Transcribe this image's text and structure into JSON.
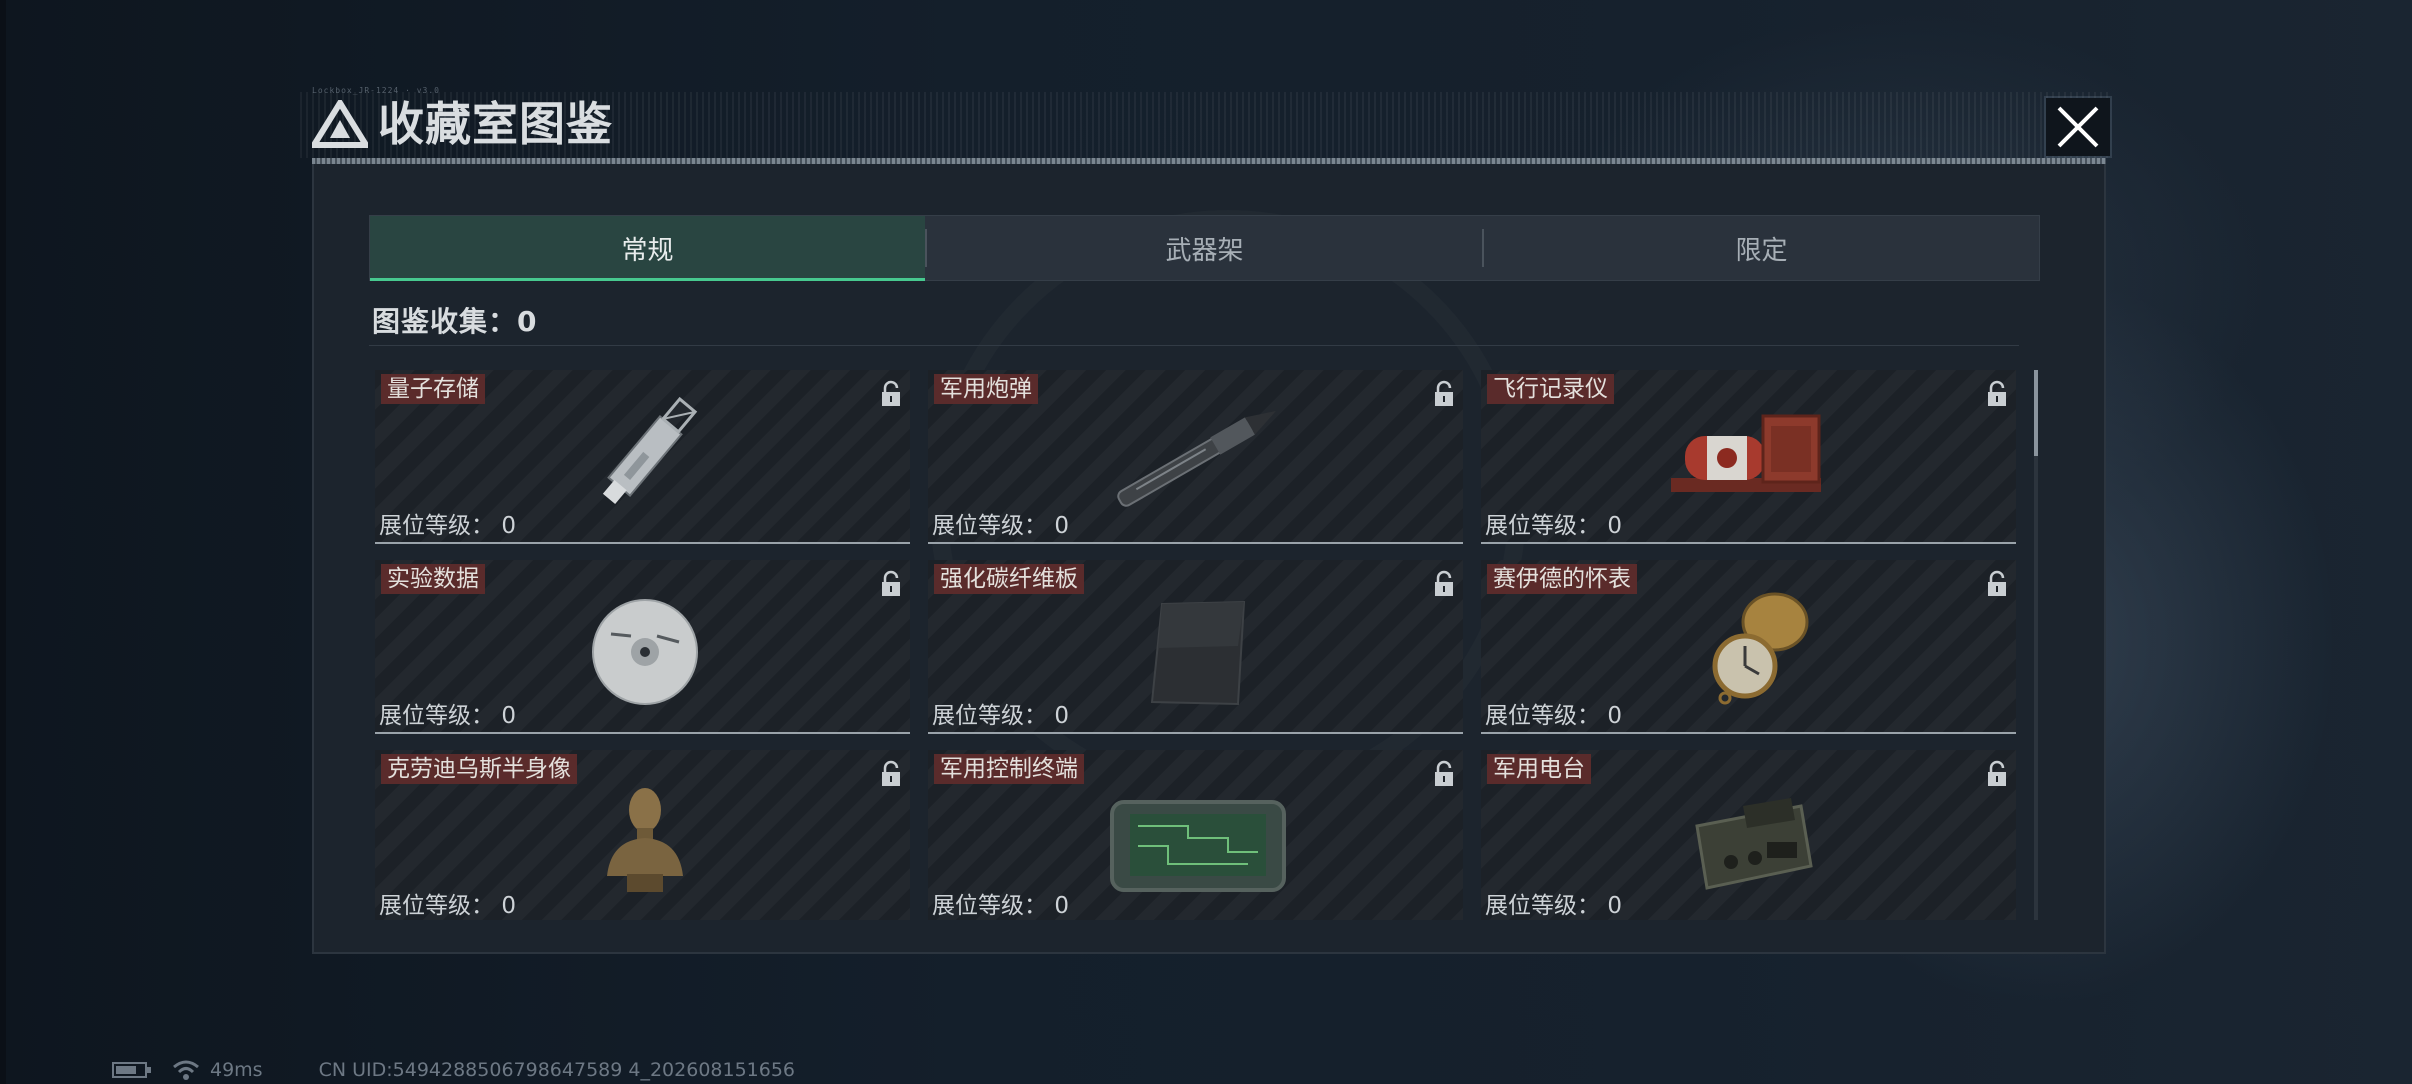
{
  "header": {
    "tag": "Lockbox_JR-1224 · v3.0",
    "title": "收藏室图鉴"
  },
  "tabs": [
    {
      "label": "常规",
      "active": true
    },
    {
      "label": "武器架",
      "active": false
    },
    {
      "label": "限定",
      "active": false
    }
  ],
  "collection": {
    "label": "图鉴收集：",
    "count": "0"
  },
  "items": [
    {
      "name": "量子存储",
      "level_label": "展位等级：",
      "level": "0",
      "icon": "usb-drive-icon"
    },
    {
      "name": "军用炮弹",
      "level_label": "展位等级：",
      "level": "0",
      "icon": "shell-icon"
    },
    {
      "name": "飞行记录仪",
      "level_label": "展位等级：",
      "level": "0",
      "icon": "flight-recorder-icon"
    },
    {
      "name": "实验数据",
      "level_label": "展位等级：",
      "level": "0",
      "icon": "disc-icon"
    },
    {
      "name": "强化碳纤维板",
      "level_label": "展位等级：",
      "level": "0",
      "icon": "carbon-plate-icon"
    },
    {
      "name": "赛伊德的怀表",
      "level_label": "展位等级：",
      "level": "0",
      "icon": "pocket-watch-icon"
    },
    {
      "name": "克劳迪乌斯半身像",
      "level_label": "展位等级：",
      "level": "0",
      "icon": "bust-icon"
    },
    {
      "name": "军用控制终端",
      "level_label": "展位等级：",
      "level": "0",
      "icon": "control-terminal-icon"
    },
    {
      "name": "军用电台",
      "level_label": "展位等级：",
      "level": "0",
      "icon": "radio-icon"
    }
  ],
  "footer": {
    "ping": "49ms",
    "uid": "CN UID:5494288506798647589 4_202608151656"
  },
  "colors": {
    "accent": "#47c98f",
    "name_tag": "#5a2b2b",
    "panel": "#1c242d"
  }
}
